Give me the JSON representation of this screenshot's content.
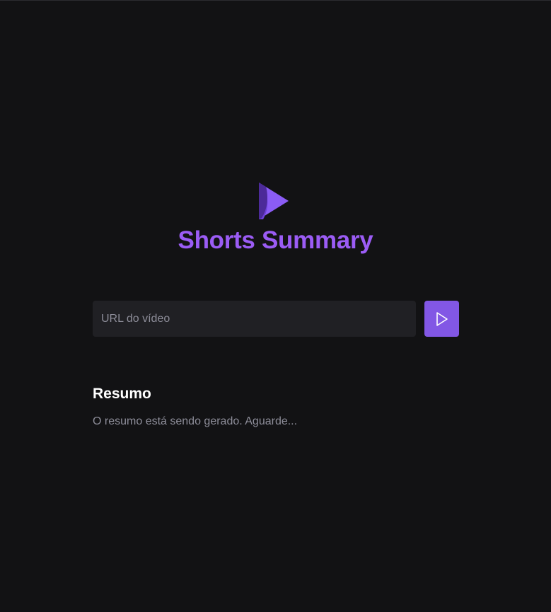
{
  "app": {
    "title": "Shorts Summary",
    "logo_icon": "play-logo-icon"
  },
  "search": {
    "placeholder": "URL do vídeo",
    "value": "",
    "submit_icon": "play-icon"
  },
  "summary": {
    "heading": "Resumo",
    "status_text": "O resumo está sendo gerado. Aguarde..."
  },
  "colors": {
    "background": "#121214",
    "accent": "#8257e5",
    "title": "#9b5cf5",
    "input_background": "#202024",
    "muted_text": "#8d8d99"
  }
}
